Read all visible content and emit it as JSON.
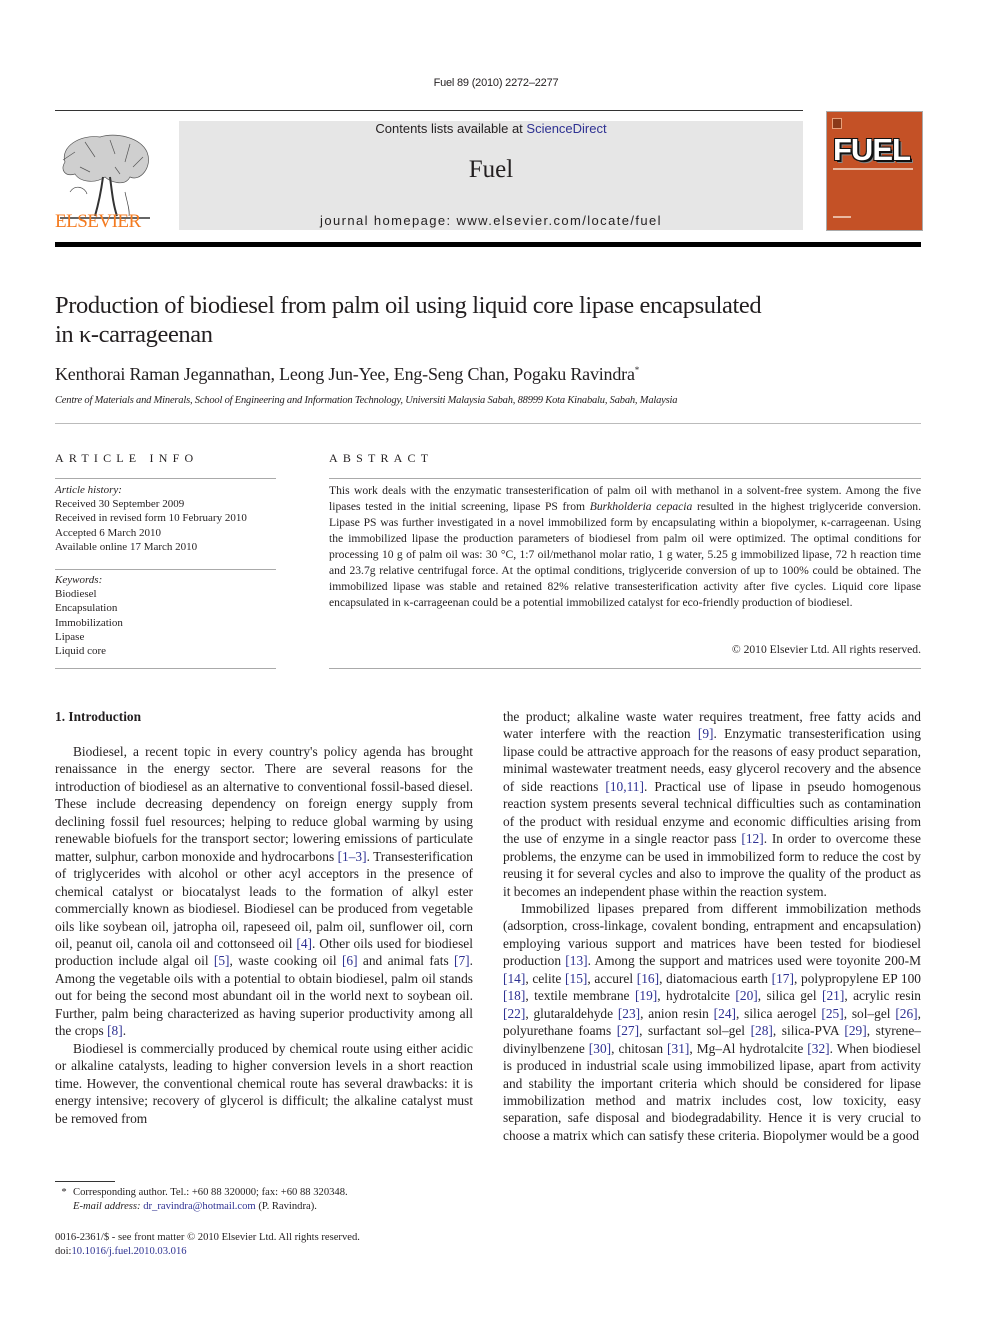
{
  "running_head": "Fuel 89 (2010) 2272–2277",
  "masthead": {
    "publisher_logo_text": "ELSEVIER",
    "contents_prefix": "Contents lists available at ",
    "contents_link": "ScienceDirect",
    "journal_name": "Fuel",
    "homepage": "journal homepage: www.elsevier.com/locate/fuel",
    "cover_title": "FUEL",
    "colors": {
      "publisher_orange": "#f47b20",
      "cover_orange": "#c45126",
      "link_blue": "#2e3192",
      "box_gray": "#e6e6e6"
    }
  },
  "article": {
    "title_line1": "Production of biodiesel from palm oil using liquid core lipase encapsulated",
    "title_line2": "in κ-carrageenan",
    "authors": "Kenthorai Raman Jegannathan, Leong Jun-Yee, Eng-Seng Chan, Pogaku Ravindra",
    "corresponding_mark": "*",
    "affiliation": "Centre of Materials and Minerals, School of Engineering and Information Technology, Universiti Malaysia Sabah, 88999 Kota Kinabalu, Sabah, Malaysia"
  },
  "article_info": {
    "heading": "ARTICLE INFO",
    "history_label": "Article history:",
    "history": [
      "Received 30 September 2009",
      "Received in revised form 10 February 2010",
      "Accepted 6 March 2010",
      "Available online 17 March 2010"
    ],
    "keywords_label": "Keywords:",
    "keywords": [
      "Biodiesel",
      "Encapsulation",
      "Immobilization",
      "Lipase",
      "Liquid core"
    ]
  },
  "abstract": {
    "heading": "ABSTRACT",
    "part1": "This work deals with the enzymatic transesterification of palm oil with methanol in a solvent-free system. Among the five lipases tested in the initial screening, lipase PS from ",
    "species": "Burkholderia cepacia",
    "part2": " resulted in the highest triglyceride conversion. Lipase PS was further investigated in a novel immobilized form by encapsulating within a biopolymer, κ-carrageenan. Using the immobilized lipase the production parameters of biodiesel from palm oil were optimized. The optimal conditions for processing 10 g of palm oil was: 30 °C, 1:7 oil/methanol molar ratio, 1 g water, 5.25 g immobilized lipase, 72 h reaction time and 23.7g relative centrifugal force. At the optimal conditions, triglyceride conversion of up to 100% could be obtained. The immobilized lipase was stable and retained 82% relative transesterification activity after five cycles. Liquid core lipase encapsulated in κ-carrageenan could be a potential immobilized catalyst for eco-friendly production of biodiesel.",
    "copyright": "© 2010 Elsevier Ltd. All rights reserved."
  },
  "body": {
    "section_heading": "1. Introduction",
    "col1": {
      "p1": [
        "Biodiesel, a recent topic in every country's policy agenda has brought renaissance in the energy sector. There are several reasons for the introduction of biodiesel as an alternative to conventional fossil-based diesel. These include decreasing dependency on for­eign energy supply from declining fossil fuel resources; helping to reduce global warming by using renewable biofuels for the transport sector; lowering emissions of particulate matter, sulphur, carbon monoxide and hydrocarbons ",
        "[1–3]",
        ". Transesterification of triglycerides with alcohol or other acyl acceptors in the presence of chemical catalyst or biocatalyst leads to the formation of alkyl ester commercially known as biodiesel. Biodiesel can be produced from vegetable oils like soybean oil, jatropha oil, rapeseed oil, palm oil, sunflower oil, corn oil, peanut oil, canola oil and cottonseed oil ",
        "[4]",
        ". Other oils used for biodiesel production include algal oil ",
        "[5]",
        ", waste cooking oil ",
        "[6]",
        " and animal fats ",
        "[7]",
        ". Among the vegetable oils with a potential to obtain biodiesel, palm oil stands out for being the second most abundant oil in the world next to soybean oil. Fur­ther, palm being characterized as having superior productivity among all the crops ",
        "[8]",
        "."
      ],
      "p2": "Biodiesel is commercially produced by chemical route using either acidic or alkaline catalysts, leading to higher conversion lev­els in a short reaction time. However, the conventional chemical route has several drawbacks: it is energy intensive; recovery of glycerol is difficult; the alkaline catalyst must be removed from"
    },
    "col2": {
      "p1": [
        "the product; alkaline waste water requires treatment, free fatty acids and water interfere with the reaction ",
        "[9]",
        ". Enzymatic transesterification using lipase could be attractive approach for the reasons of easy product separation, minimal wastewater treatment needs, easy glycerol recovery and the absence of side reactions ",
        "[10,11]",
        ". Practical use of lipase in pseudo homogenous reaction system presents several technical difficulties such as contamination of the product with residual enzyme and economic difficulties arising from the use of enzyme in a single reactor pass ",
        "[12]",
        ". In order to overcome these problems, the enzyme can be used in immobilized form to reduce the cost by reusing it for several cycles and also to improve the quality of the product as it becomes an independent phase within the reaction system."
      ],
      "p2": [
        "Immobilized lipases prepared from different immobilization methods (adsorption, cross-linkage, covalent bonding, entrapment and encapsulation) employing various support and matrices have been tested for biodiesel production ",
        "[13]",
        ". Among the support and matrices used were toyonite 200-M ",
        "[14]",
        ", celite ",
        "[15]",
        ", accurel ",
        "[16]",
        ", diatomacious earth ",
        "[17]",
        ", polypropylene EP 100 ",
        "[18]",
        ", textile mem­brane ",
        "[19]",
        ", hydrotalcite ",
        "[20]",
        ", silica gel ",
        "[21]",
        ", acrylic resin ",
        "[22]",
        ", glu­taraldehyde ",
        "[23]",
        ", anion resin ",
        "[24]",
        ", silica aerogel ",
        "[25]",
        ", sol–gel ",
        "[26]",
        ", polyurethane foams ",
        "[27]",
        ", surfactant sol–gel ",
        "[28]",
        ", silica-PVA ",
        "[29]",
        ", styrene–divinylbenzene ",
        "[30]",
        ", chitosan ",
        "[31]",
        ", Mg–Al hydrotalcite ",
        "[32]",
        ". When biodiesel is produced in industrial scale using immobi­lized lipase, apart from activity and stability the important criteria which should be considered for lipase immobilization method and matrix includes cost, low toxicity, easy separation, safe disposal and biodegradability. Hence it is very crucial to choose a matrix which can satisfy these criteria. Biopolymer would be a good"
      ]
    }
  },
  "footnote": {
    "star": "*",
    "corresponding": "Corresponding author. Tel.: +60 88 320000; fax: +60 88 320348.",
    "email_label": "E-mail address:",
    "email": "dr_ravindra@hotmail.com",
    "email_suffix": " (P. Ravindra)."
  },
  "front_matter": {
    "issn_line": "0016-2361/$ - see front matter © 2010 Elsevier Ltd. All rights reserved.",
    "doi_prefix": "doi:",
    "doi": "10.1016/j.fuel.2010.03.016"
  }
}
